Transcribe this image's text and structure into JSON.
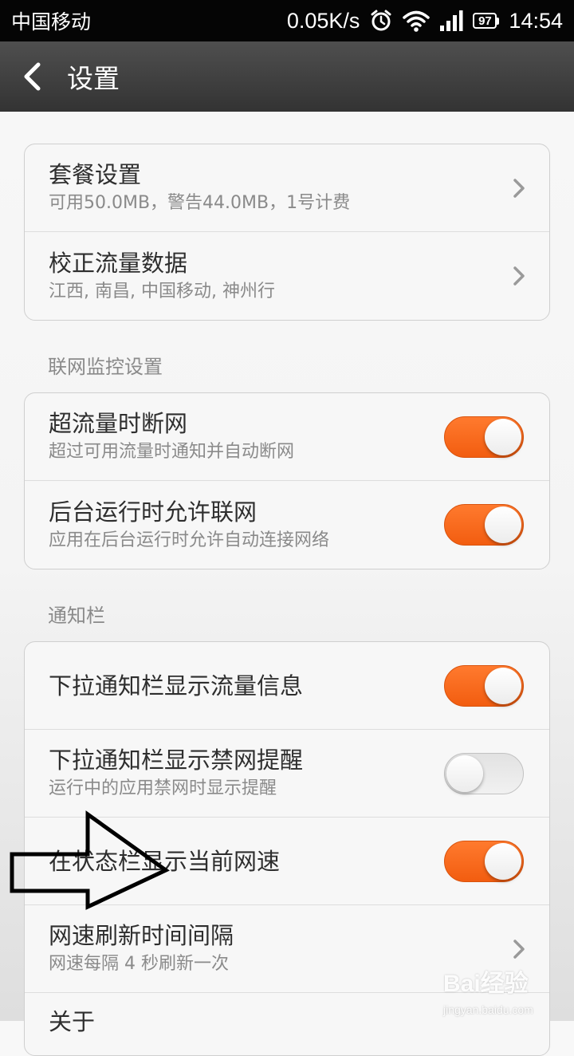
{
  "status_bar": {
    "carrier": "中国移动",
    "net_speed": "0.05K/s",
    "battery_level": "97",
    "time": "14:54",
    "icons": [
      "alarm-icon",
      "wifi-icon",
      "signal-icon",
      "battery-icon"
    ]
  },
  "title_bar": {
    "back_icon": "back-arrow-icon",
    "title": "设置"
  },
  "plan_card": [
    {
      "title": "套餐设置",
      "subtitle": "可用50.0MB，警告44.0MB，1号计费"
    },
    {
      "title": "校正流量数据",
      "subtitle": "江西, 南昌, 中国移动, 神州行"
    }
  ],
  "monitor_section": {
    "header": "联网监控设置",
    "rows": [
      {
        "title": "超流量时断网",
        "subtitle": "超过可用流量时通知并自动断网",
        "toggle_on": true
      },
      {
        "title": "后台运行时允许联网",
        "subtitle": "应用在后台运行时允许自动连接网络",
        "toggle_on": true
      }
    ]
  },
  "notify_section": {
    "header": "通知栏",
    "rows": [
      {
        "title": "下拉通知栏显示流量信息",
        "toggle_on": true
      },
      {
        "title": "下拉通知栏显示禁网提醒",
        "subtitle": "运行中的应用禁网时显示提醒",
        "toggle_on": false
      },
      {
        "title": "在状态栏显示当前网速",
        "toggle_on": true
      },
      {
        "title": "网速刷新时间间隔",
        "subtitle": "网速每隔 4 秒刷新一次"
      },
      {
        "title": "关于"
      }
    ]
  },
  "watermark": {
    "brand": "Bai经验",
    "site": "jingyan.baidu.com"
  },
  "colors": {
    "toggle_on": "#f25d10",
    "toggle_off": "#e6e6e6",
    "title_bar": "#3f3f3f",
    "status_bar": "#050505"
  }
}
